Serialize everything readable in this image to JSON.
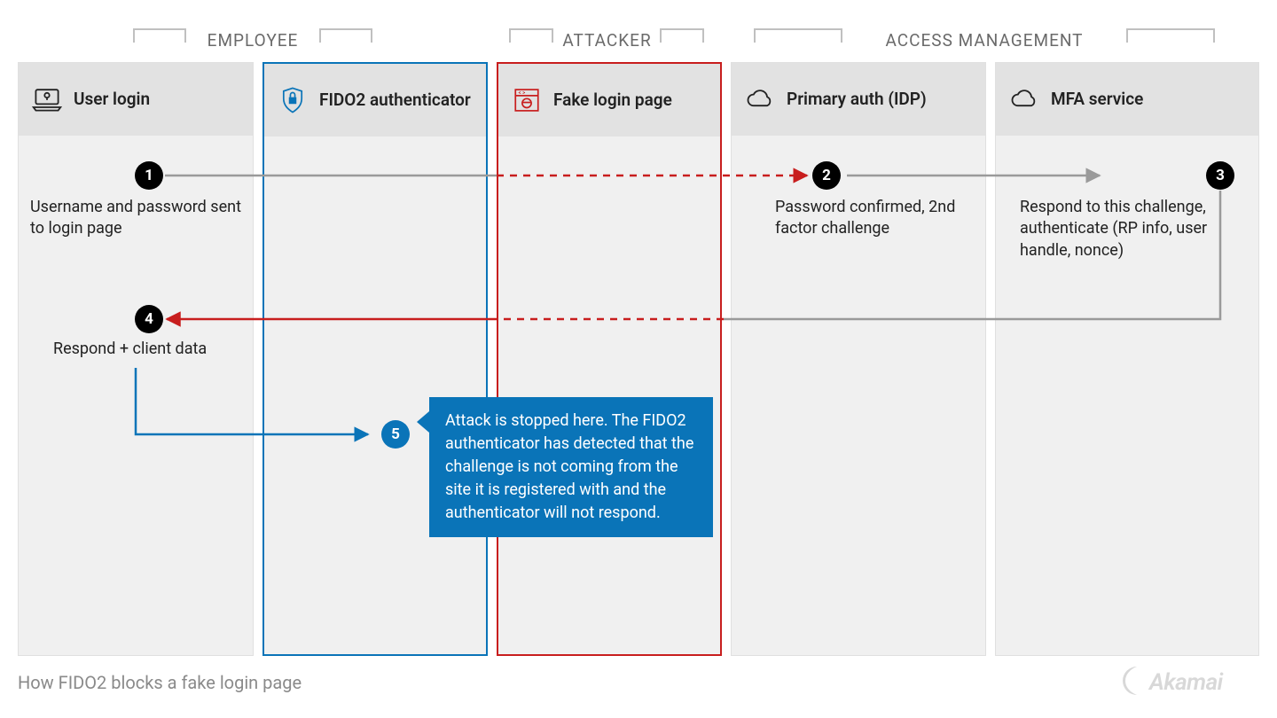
{
  "groups": {
    "employee": "EMPLOYEE",
    "attacker": "ATTACKER",
    "access": "ACCESS MANAGEMENT"
  },
  "lanes": {
    "user": "User login",
    "fido": "FIDO2 authenticator",
    "fake": "Fake login page",
    "idp": "Primary auth (IDP)",
    "mfa": "MFA service"
  },
  "steps": {
    "s1": {
      "n": "1",
      "text": "Username and password sent to login page"
    },
    "s2": {
      "n": "2",
      "text": "Password confirmed, 2nd factor challenge"
    },
    "s3": {
      "n": "3",
      "text": "Respond to this challenge, authenticate (RP info, user handle, nonce)"
    },
    "s4": {
      "n": "4",
      "text": "Respond + client data"
    },
    "s5": {
      "n": "5",
      "text": "Attack is stopped here. The FIDO2 authenticator has detected that the challenge is not coming from the site it is registered with and the authenticator will not respond."
    }
  },
  "caption": "How FIDO2 blocks a fake login page",
  "brand": "Akamai",
  "colors": {
    "blue": "#0a74b8",
    "red": "#c81e1e",
    "gray": "#9a9a9a"
  }
}
